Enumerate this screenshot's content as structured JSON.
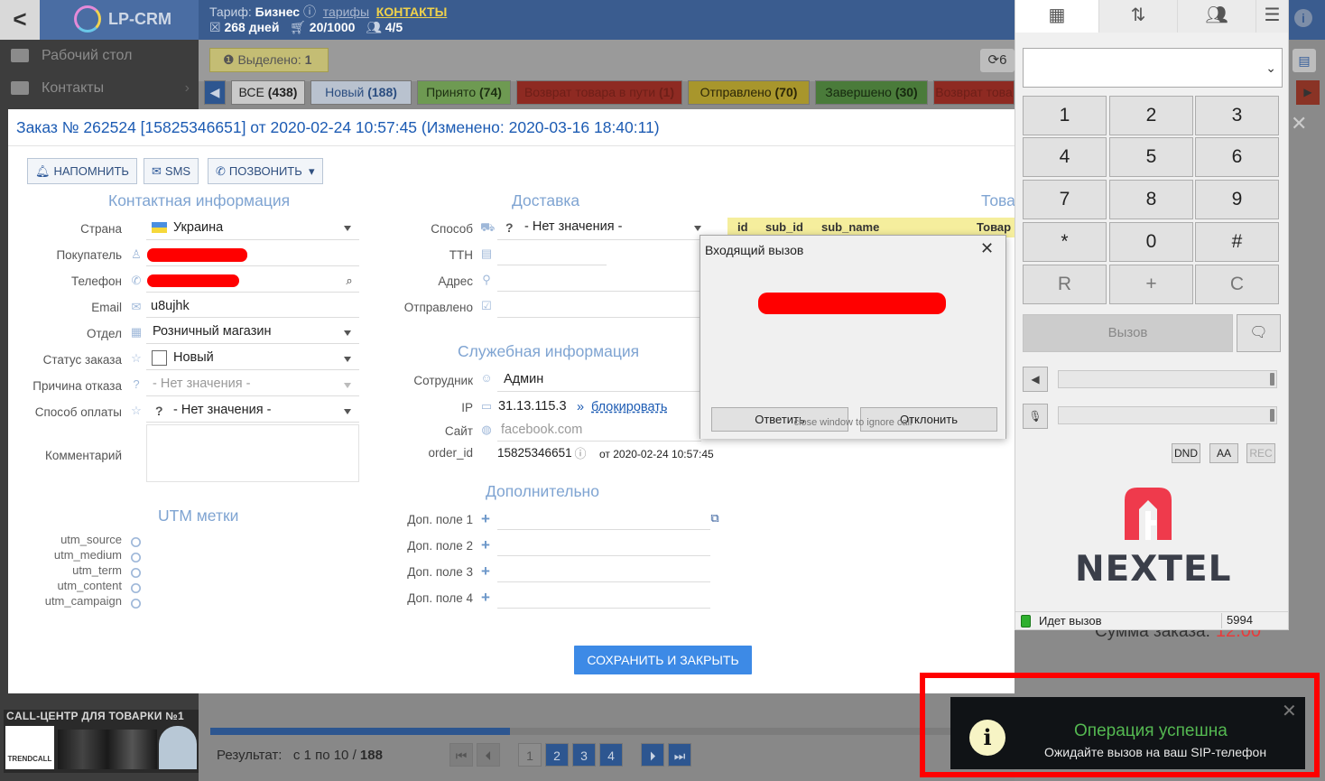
{
  "app": {
    "back_glyph": "<",
    "logo_text": "LP-CRM",
    "tariff_label": "Тариф:",
    "tariff_value": "Бизнес",
    "tariffs_link": "тарифы",
    "contacts_link": "КОНТАКТЫ",
    "days": "268 дней",
    "orders_quota": "20/1000",
    "users_quota": "4/5"
  },
  "sidebar": {
    "items": [
      {
        "label": "Рабочий стол",
        "icon": "desktop-icon"
      },
      {
        "label": "Контакты",
        "icon": "users-icon"
      }
    ],
    "ad_text": "CALL-ЦЕНТР ДЛЯ ТОВАРКИ №1",
    "ad_logo": "TRENDCALL"
  },
  "toolbar": {
    "selected_label": "Выделено:",
    "selected_count": "1",
    "refresh_partial": "6"
  },
  "status_tabs": [
    {
      "label": "ВСЕ",
      "count": "(438)",
      "bg": "#c9c9c9",
      "fg": "#222"
    },
    {
      "label": "Новый",
      "count": "(188)",
      "bg": "#b9c2cf",
      "fg": "#2b4d80"
    },
    {
      "label": "Принято",
      "count": "(74)",
      "bg": "#6e9a52",
      "fg": "#1d3012"
    },
    {
      "label": "Возврат товара в пути",
      "count": "(1)",
      "bg": "#8e2a22",
      "fg": "#6e1f18"
    },
    {
      "label": "Отправлено",
      "count": "(70)",
      "bg": "#a8962c",
      "fg": "#2b2607"
    },
    {
      "label": "Завершено",
      "count": "(30)",
      "bg": "#4a7b3a",
      "fg": "#16290f"
    },
    {
      "label": "Возврат това",
      "count": "",
      "bg": "#8e2a22",
      "fg": "#6e1f18"
    }
  ],
  "order": {
    "title": "Заказ № 262524 [15825346651] от 2020-02-24 10:57:45 (Изменено: 2020-03-16 18:40:11)",
    "remind_button": "НАПОМНИТЬ",
    "sms_button": "SMS",
    "call_button": "ПОЗВОНИТЬ",
    "contact_section": "Контактная информация",
    "delivery_section": "Доставка",
    "goods_section": "Това",
    "service_section": "Служебная информация",
    "extra_section": "Дополнительно",
    "utm_section": "UTM метки",
    "fields": {
      "country_label": "Страна",
      "country_value": "Украина",
      "buyer_label": "Покупатель",
      "phone_label": "Телефон",
      "email_label": "Email",
      "email_value": "u8ujhk",
      "dept_label": "Отдел",
      "dept_value": "Розничный магазин",
      "status_label": "Статус заказа",
      "status_value": "Новый",
      "reject_label": "Причина отказа",
      "reject_value": "- Нет значения -",
      "payment_label": "Способ оплаты",
      "payment_value": "- Нет значения -",
      "comment_label": "Комментарий"
    },
    "delivery": {
      "method_label": "Способ",
      "method_value": "- Нет значения -",
      "ttn_label": "ТТН",
      "address_label": "Адрес",
      "sent_label": "Отправлено"
    },
    "service": {
      "employee_label": "Сотрудник",
      "employee_value": "Админ",
      "ip_label": "IP",
      "ip_value": "31.13.115.3",
      "block_link": "блокировать",
      "site_label": "Сайт",
      "site_value": "facebook.com",
      "order_id_label": "order_id",
      "order_id_value": "15825346651",
      "order_id_date": "от 2020-02-24 10:57:45"
    },
    "extra": {
      "fields": [
        "Доп. поле 1",
        "Доп. поле 2",
        "Доп. поле 3",
        "Доп. поле 4"
      ]
    },
    "utm": [
      "utm_source",
      "utm_medium",
      "utm_term",
      "utm_content",
      "utm_campaign"
    ],
    "goods_columns": [
      "id",
      "sub_id",
      "sub_name",
      "Товар"
    ],
    "sum_label": "Сумма заказа:",
    "sum_value": "12.00",
    "save_button": "СОХРАНИТЬ И ЗАКРЫТЬ"
  },
  "incoming_call": {
    "title": "Входящий вызов",
    "answer": "Ответить",
    "decline": "Отклонить",
    "hint": "close window to ignore call"
  },
  "softphone": {
    "tabs": [
      "keypad-icon",
      "transfer-icon",
      "contacts-icon",
      "menu-icon"
    ],
    "keys": [
      "1",
      "2",
      "3",
      "4",
      "5",
      "6",
      "7",
      "8",
      "9",
      "*",
      "0",
      "#",
      "R",
      "+",
      "C"
    ],
    "call_button": "Вызов",
    "dnd": "DND",
    "aa": "AA",
    "rec": "REC",
    "brand": "NEXTEL",
    "status": "Идет вызов",
    "extension": "5994"
  },
  "pagination": {
    "result_label": "Результат:",
    "range": "с 1 по 10 /",
    "total": "188",
    "pages": [
      "1",
      "2",
      "3",
      "4"
    ]
  },
  "toast": {
    "title": "Операция успешна",
    "message": "Ожидайте вызов на ваш SIP-телефон"
  },
  "colors": {
    "brand_blue": "#3d8ae6",
    "title_blue": "#1c5bb3",
    "section_blue": "#7fa4d2",
    "success_green": "#54b851",
    "highlight_red": "#ff0000"
  }
}
